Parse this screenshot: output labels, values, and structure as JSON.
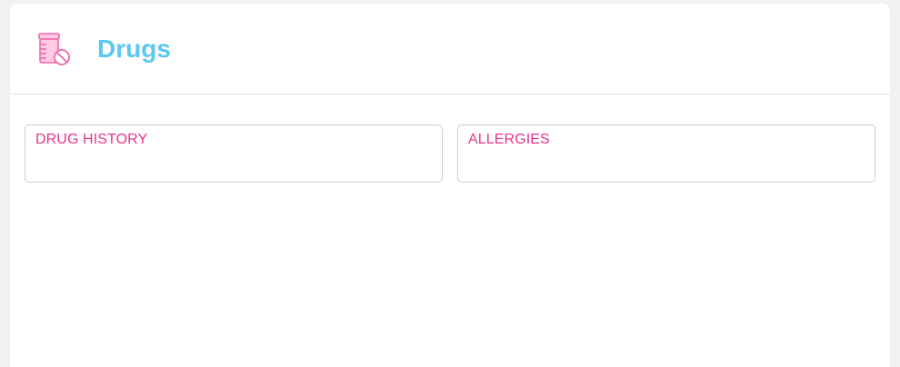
{
  "colors": {
    "title": "#5ac8f0",
    "label": "#e8348c",
    "icon": "#f06aa8",
    "icon_light": "#ffc8e3"
  },
  "header": {
    "icon": "pill-bottle-prohibited-icon",
    "title": "Drugs"
  },
  "fields": [
    {
      "label": "DRUG HISTORY",
      "value": ""
    },
    {
      "label": "ALLERGIES",
      "value": ""
    }
  ]
}
